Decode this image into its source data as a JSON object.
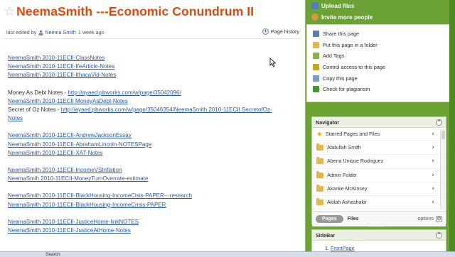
{
  "page": {
    "title": "NeemaSmith ---Economic Conundrum II",
    "meta_prefix": "last edited by",
    "editor": "Neema Smith",
    "edited_ago": "1 week ago",
    "history_label": "Page history"
  },
  "content": {
    "lines": [
      {
        "type": "link",
        "text": "NeemaSmith 2010-11ECII-ClassNotes"
      },
      {
        "type": "link",
        "text": "NeemaSmith 2010-11ECII-IfeArticle-Notes"
      },
      {
        "type": "link",
        "text": "NeemaSmith 2010-11ECII-IthacaVid-Notes"
      },
      {
        "type": "gap"
      },
      {
        "type": "mixed",
        "prefix": "Money As Debt Notes - ",
        "link": "http://ayaed.pbworks.com/w/page/35042096/"
      },
      {
        "type": "link",
        "text": "NeemaSmith 2010-11ECII MoneyAsDebt-Notes"
      },
      {
        "type": "mixed",
        "prefix": "Secret of Oz Notes - ",
        "link": "http://ayaed.pbworks.com/w/page/35046354/NeemaSmith 2010-11ECII SecretofOz-"
      },
      {
        "type": "link",
        "text": "Notes"
      },
      {
        "type": "gap"
      },
      {
        "type": "link",
        "text": "NeemaSmith 2010-11ECII-AndrewJacksonEssay"
      },
      {
        "type": "link",
        "text": "NeemaSmith 2010-11ECII-AbrahamLincoln-NOTESPage"
      },
      {
        "type": "link",
        "text": "NeemaSmith 2010-11ECII-XAT-Notes"
      },
      {
        "type": "gap"
      },
      {
        "type": "link",
        "text": "NeemaSmith 2010-11ECII-IncomeVSInflation"
      },
      {
        "type": "link",
        "text": "NeemaSmih 2010-11ECII-MoneyTurnOverrate-estimate"
      },
      {
        "type": "gap"
      },
      {
        "type": "link",
        "text": "NeemaSmith 2010-11ECII-BlackHousing-IncomeCisis-PAPER---research"
      },
      {
        "type": "link",
        "text": "NeemaSmith 2010-11ECII-BlackHousing-IncomeCrisis-PAPER"
      },
      {
        "type": "gap"
      },
      {
        "type": "link",
        "text": "NeemaSmith 2010-11ECII-JusticeHome-linkNOTES"
      },
      {
        "type": "link",
        "text": "NeemaSmith 2010-11ECII-JusticeAtHome-Notes"
      }
    ]
  },
  "top_actions": {
    "upload": "Upload files",
    "invite": "Invite more people"
  },
  "actions": [
    {
      "label": "Share this page",
      "icon": "share-icon",
      "color": "#5b7fb5"
    },
    {
      "label": "Put this page in a folder",
      "icon": "folder-icon",
      "color": "#e5b64a"
    },
    {
      "label": "Add Tags",
      "icon": "tag-icon",
      "color": "#8ab04f"
    },
    {
      "label": "Control access to this page",
      "icon": "lock-icon",
      "color": "#c9a227"
    },
    {
      "label": "Copy this page",
      "icon": "copy-icon",
      "color": "#7a9cc6"
    },
    {
      "label": "Check for plagiarism",
      "icon": "check-icon",
      "color": "#3a9a2f"
    }
  ],
  "navigator": {
    "title": "Navigator",
    "items": [
      {
        "label": "Starred Pages and Files",
        "kind": "star"
      },
      {
        "label": "Abdullah Smith",
        "kind": "folder"
      },
      {
        "label": "Abena Unique Rodriguez",
        "kind": "folder"
      },
      {
        "label": "Admin Folder",
        "kind": "folder"
      },
      {
        "label": "Akanke McKinsey",
        "kind": "folder"
      },
      {
        "label": "Akilah Ashashakir",
        "kind": "folder"
      }
    ],
    "tab_pages": "Pages",
    "tab_files": "Files",
    "options": "options"
  },
  "sidebar": {
    "title": "SideBar",
    "item_number": "1.",
    "item_link": "FrontPage"
  },
  "taskbar": {
    "search": "Search"
  },
  "colors": {
    "title": "#e04a0e",
    "link": "#2a5aa8",
    "sidebar_bg": "#6aa234"
  }
}
